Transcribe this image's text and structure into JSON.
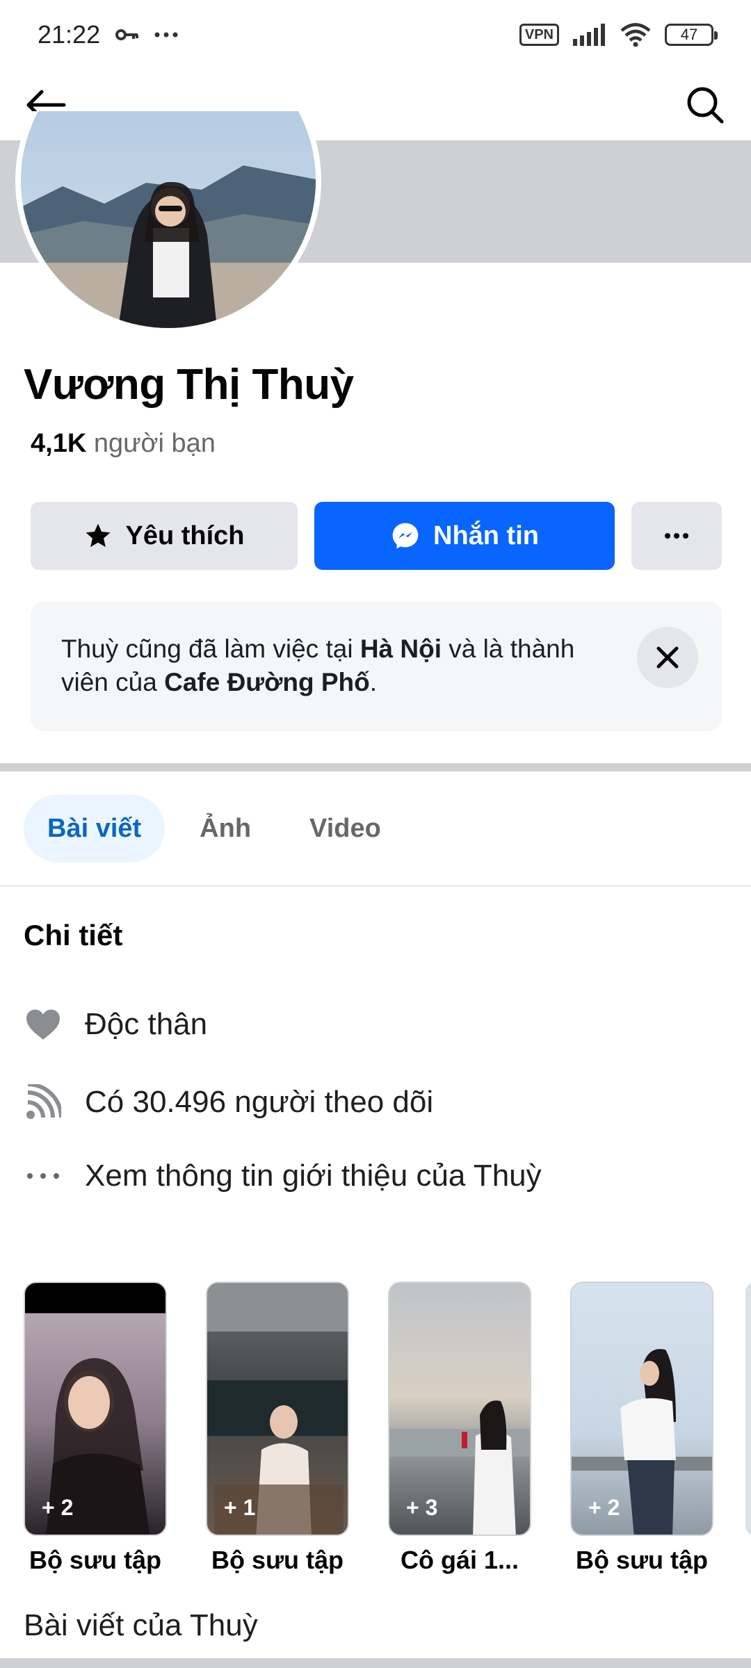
{
  "status_bar": {
    "time": "21:22",
    "vpn_label": "VPN",
    "battery": "47",
    "icons": [
      "key-icon",
      "more-dots-icon",
      "signal-icon",
      "wifi-icon",
      "battery-icon"
    ]
  },
  "nav": {
    "back_icon": "arrow-left-icon",
    "search_icon": "search-icon"
  },
  "profile": {
    "name": "Vương Thị Thuỳ",
    "friend_count": "4,1K",
    "friend_label": "người bạn"
  },
  "actions": {
    "favorite_label": "Yêu thích",
    "message_label": "Nhắn tin",
    "more_label": "···"
  },
  "notice": {
    "part1": "Thuỳ cũng đã làm việc tại ",
    "place": "Hà Nội",
    "part2": " và là thành viên của ",
    "group": "Cafe Đường Phố",
    "part3": "."
  },
  "tabs": [
    {
      "label": "Bài viết",
      "active": true
    },
    {
      "label": "Ảnh",
      "active": false
    },
    {
      "label": "Video",
      "active": false
    }
  ],
  "details": {
    "title": "Chi tiết",
    "items": [
      {
        "icon": "heart-icon",
        "text": "Độc thân"
      },
      {
        "icon": "rss-icon",
        "text": "Có 30.496 người theo dõi"
      },
      {
        "icon": "more-dots-icon",
        "text": "Xem thông tin giới thiệu của Thuỳ"
      }
    ]
  },
  "featured": [
    {
      "label": "Bộ sưu tập",
      "count": "+ 2"
    },
    {
      "label": "Bộ sưu tập",
      "count": "+ 1"
    },
    {
      "label": "Cô gái 1...",
      "count": "+ 3"
    },
    {
      "label": "Bộ sưu tập",
      "count": "+ 2"
    }
  ],
  "posts_title": "Bài viết của Thuỳ",
  "colors": {
    "accent": "#0866ff",
    "tab_active_bg": "#ebf5ff",
    "tab_active_text": "#0a66c2",
    "gray_button": "#e4e6eb"
  }
}
